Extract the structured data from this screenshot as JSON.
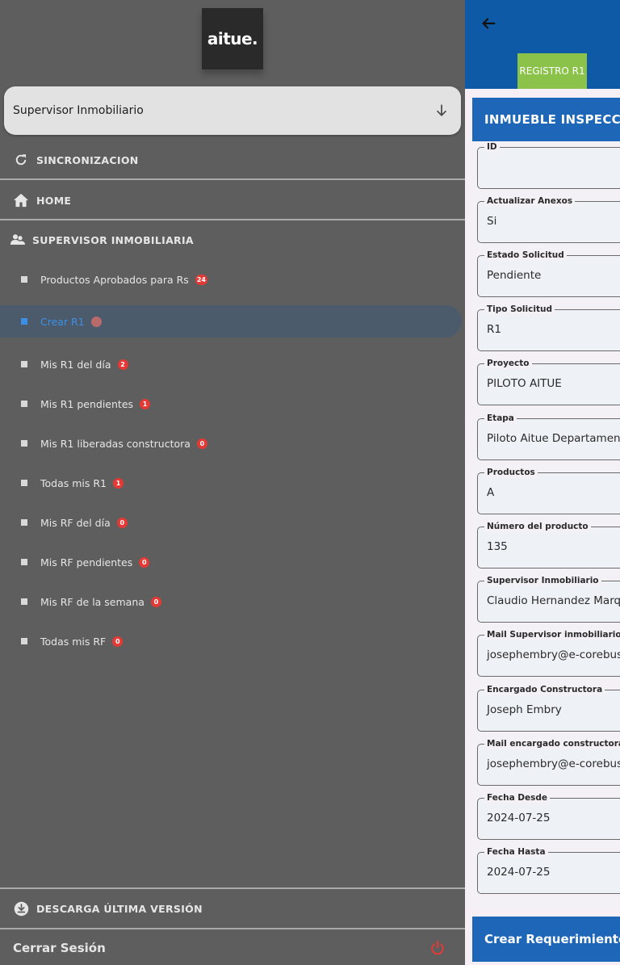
{
  "drawer": {
    "logo_text": "aitue.",
    "role_selector": {
      "value": "Supervisor Inmobiliario"
    },
    "sync_label": "SINCRONIZACION",
    "home_label": "HOME",
    "section_label": "SUPERVISOR INMOBILIARIA",
    "items": [
      {
        "label": "Productos Aprobados para Rs",
        "badge": "24"
      },
      {
        "label": "Crear R1",
        "badge": "0"
      },
      {
        "label": "Mis R1 del día",
        "badge": "2"
      },
      {
        "label": "Mis R1 pendientes",
        "badge": "1"
      },
      {
        "label": "Mis R1 liberadas constructora",
        "badge": "0"
      },
      {
        "label": "Todas mis R1",
        "badge": "1"
      },
      {
        "label": "Mis RF del día",
        "badge": "0"
      },
      {
        "label": "Mis RF pendientes",
        "badge": "0"
      },
      {
        "label": "Mis RF de la semana",
        "badge": "0"
      },
      {
        "label": "Todas mis RF",
        "badge": "0"
      }
    ],
    "download_label": "DESCARGA ÚLTIMA VERSIÓN",
    "logout_label": "Cerrar Sesión"
  },
  "panel": {
    "register_button": "REGISTRO R1",
    "section_title": "INMUEBLE INSPECCI",
    "fields": [
      {
        "label": "ID",
        "value": ""
      },
      {
        "label": "Actualizar Anexos",
        "value": "Si"
      },
      {
        "label": "Estado Solicitud",
        "value": "Pendiente"
      },
      {
        "label": "Tipo Solicitud",
        "value": "R1"
      },
      {
        "label": "Proyecto",
        "value": "PILOTO AITUE"
      },
      {
        "label": "Etapa",
        "value": "Piloto Aitue Departament"
      },
      {
        "label": "Productos",
        "value": "A"
      },
      {
        "label": "Número del producto",
        "value": "135"
      },
      {
        "label": "Supervisor Inmobiliario",
        "value": "Claudio Hernandez Marqu"
      },
      {
        "label": "Mail Supervisor inmobiliario",
        "value": "josephembry@e-corebusi"
      },
      {
        "label": "Encargado Constructora",
        "value": "Joseph Embry"
      },
      {
        "label": "Mail encargado constructora",
        "value": "josephembry@e-corebusi"
      },
      {
        "label": "Fecha Desde",
        "value": "2024-07-25"
      },
      {
        "label": "Fecha Hasta",
        "value": "2024-07-25"
      }
    ],
    "create_button": "Crear Requerimientos"
  },
  "colors": {
    "drawer_bg": "#5e5e5e",
    "header_blue": "#0f5aa6",
    "section_blue": "#1e67b8",
    "register_green": "#8bc34a",
    "badge_red": "#e53935",
    "active_blue": "#3d8fe6"
  },
  "icons": {
    "sync": "sync-icon",
    "home": "home-icon",
    "group": "group-icon",
    "download": "download-icon",
    "power": "power-icon",
    "back": "arrow-back-icon",
    "dropdown": "arrow-down-icon"
  }
}
